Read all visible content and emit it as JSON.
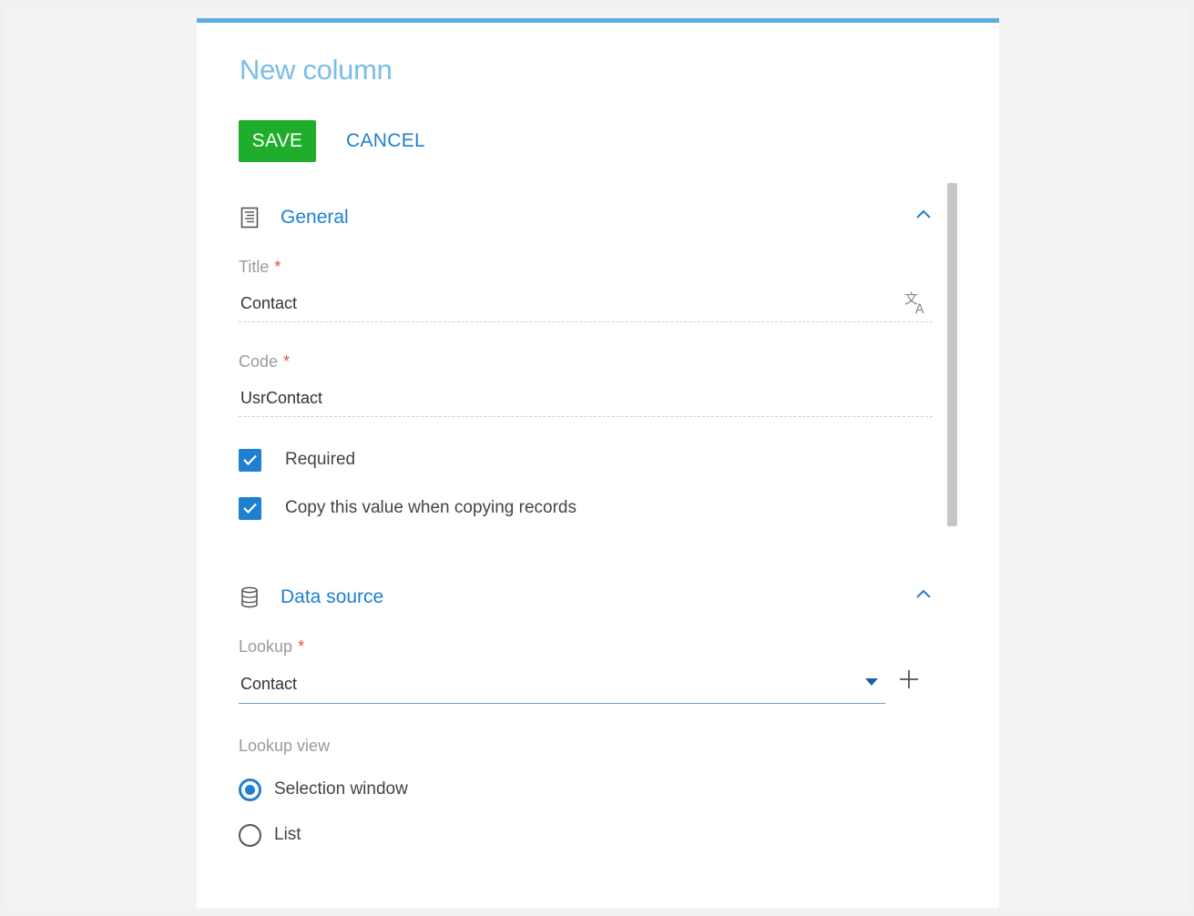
{
  "dialog": {
    "title": "New column",
    "save_label": "SAVE",
    "cancel_label": "CANCEL"
  },
  "general": {
    "heading": "General",
    "title_label": "Title",
    "title_value": "Contact",
    "code_label": "Code",
    "code_value": "UsrContact",
    "required_label": "Required",
    "required_checked": true,
    "copy_label": "Copy this value when copying records",
    "copy_checked": true,
    "required_marker": "*"
  },
  "data_source": {
    "heading": "Data source",
    "lookup_label": "Lookup",
    "lookup_value": "Contact",
    "lookup_view_label": "Lookup view",
    "options": [
      {
        "label": "Selection window",
        "selected": true
      },
      {
        "label": "List",
        "selected": false
      }
    ]
  },
  "colors": {
    "accent": "#1f7fd0",
    "save_button": "#1fad2c",
    "title": "#7bbde8",
    "top_border": "#5dade2",
    "required": "#e0503a"
  },
  "icons": {
    "general": "document-list-icon",
    "data_source": "database-icon",
    "collapse": "chevron-up-icon",
    "translate": "translate-icon",
    "dropdown": "caret-down-icon",
    "add": "plus-icon"
  }
}
